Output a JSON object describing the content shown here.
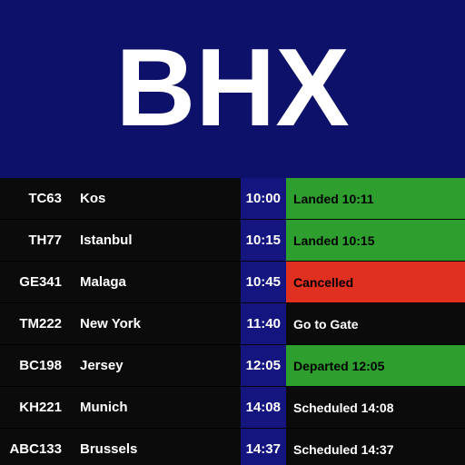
{
  "header": {
    "airport_code": "BHX",
    "background_color": "#0d1169",
    "text_color": "#ffffff"
  },
  "colors": {
    "row_background": "#0b0b0b",
    "time_background": "#151580",
    "status_ok_background": "#2e9e2e",
    "status_cancelled_background": "#e03020",
    "status_ok_text": "#000000",
    "status_cancelled_text": "#000000",
    "status_default_text": "#ffffff"
  },
  "flights": [
    {
      "flight": "TC63",
      "destination": "Kos",
      "time": "10:00",
      "status": "Landed 10:11",
      "status_type": "ok"
    },
    {
      "flight": "TH77",
      "destination": "Istanbul",
      "time": "10:15",
      "status": "Landed 10:15",
      "status_type": "ok"
    },
    {
      "flight": "GE341",
      "destination": "Malaga",
      "time": "10:45",
      "status": "Cancelled",
      "status_type": "cancelled"
    },
    {
      "flight": "TM222",
      "destination": "New York",
      "time": "11:40",
      "status": "Go to Gate",
      "status_type": "default"
    },
    {
      "flight": "BC198",
      "destination": "Jersey",
      "time": "12:05",
      "status": "Departed 12:05",
      "status_type": "ok"
    },
    {
      "flight": "KH221",
      "destination": "Munich",
      "time": "14:08",
      "status": "Scheduled 14:08",
      "status_type": "default"
    },
    {
      "flight": "ABC133",
      "destination": "Brussels",
      "time": "14:37",
      "status": "Scheduled 14:37",
      "status_type": "default"
    }
  ]
}
